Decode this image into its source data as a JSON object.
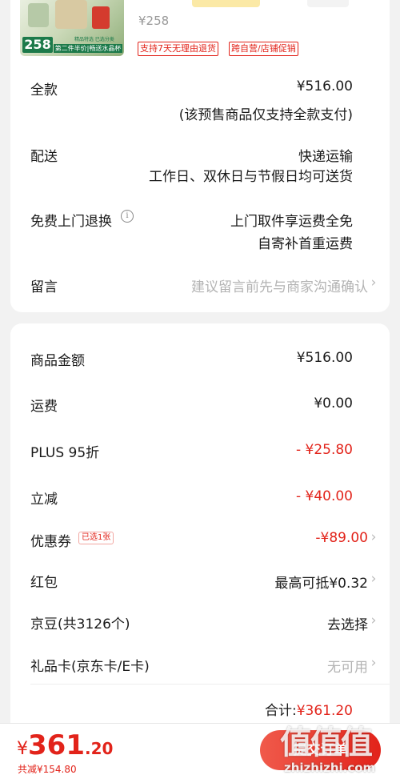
{
  "product": {
    "price": "¥258",
    "thumb_price": "258",
    "thumb_promo": "第二件半价|畅送水晶杯",
    "thumb_small": "精品特选 已选分类",
    "tags": [
      "支持7天无理由退货",
      "跨自营/店铺促销"
    ]
  },
  "order": {
    "payment_label": "全款",
    "payment_value": "¥516.00",
    "payment_note": "(该预售商品仅支持全款支付)",
    "delivery_label": "配送",
    "delivery_value": "快递运输",
    "delivery_note": "工作日、双休日与节假日均可送货",
    "return_label": "免费上门退换",
    "return_value": "上门取件享运费全免",
    "return_note": "自寄补首重运费",
    "message_label": "留言",
    "message_placeholder": "建议留言前先与商家沟通确认"
  },
  "summary": {
    "goods_label": "商品金额",
    "goods_value": "¥516.00",
    "shipping_label": "运费",
    "shipping_value": "¥0.00",
    "plus_label": "PLUS 95折",
    "plus_value": "- ¥25.80",
    "instant_label": "立减",
    "instant_value": "- ¥40.00",
    "coupon_label": "优惠券",
    "coupon_badge": "已选1张",
    "coupon_value": "-¥89.00",
    "redpacket_label": "红包",
    "redpacket_value": "最高可抵¥0.32",
    "jingdou_label": "京豆(共3126个)",
    "jingdou_value": "去选择",
    "giftcard_label": "礼品卡(京东卡/E卡)",
    "giftcard_value": "无可用",
    "total_label": "合计:",
    "total_value": "¥361.20"
  },
  "bottom": {
    "yen": "¥",
    "total_int": "361",
    "total_dec": ".20",
    "saved": "共减¥154.80",
    "submit": "提交订单"
  },
  "watermark": {
    "logo": "值值值",
    "url": "zhizhizhi.com"
  },
  "colors": {
    "accent": "#e2231a",
    "background": "#f2f2f2",
    "card": "#ffffff"
  },
  "icons": {
    "info": "info-icon",
    "chevron": "chevron-right-icon"
  }
}
